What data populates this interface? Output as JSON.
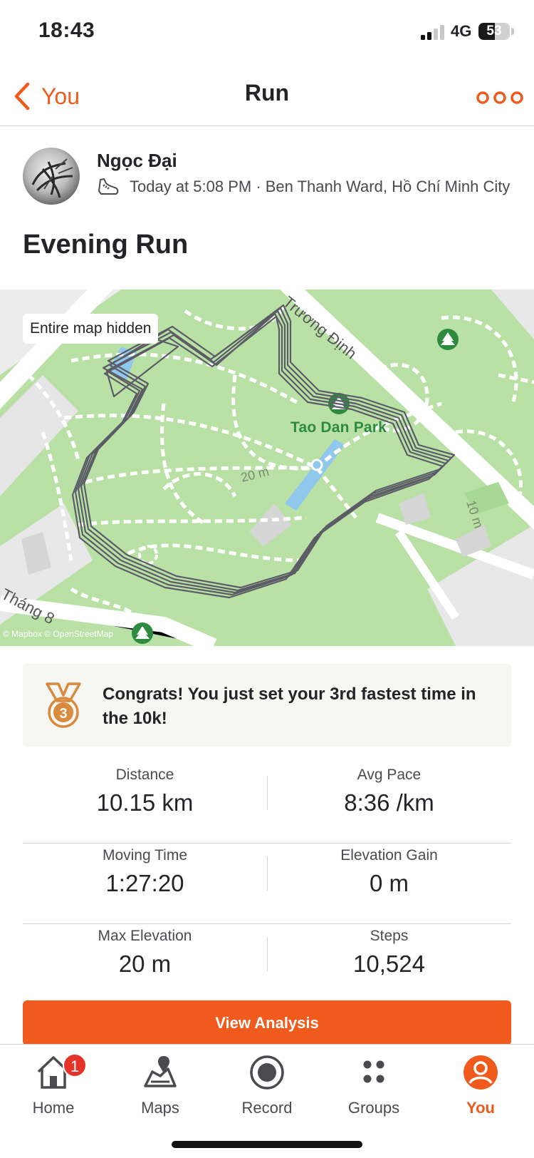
{
  "status_bar": {
    "time": "18:43",
    "network": "4G",
    "battery": "53",
    "battery_level": 0.53
  },
  "nav": {
    "back_label": "You",
    "title": "Run",
    "more_icon": "more-icon"
  },
  "athlete": {
    "name": "Ngọc Đại",
    "meta": "Today at 5:08 PM · Ben Thanh Ward, Hồ Chí Minh City",
    "activity_icon": "shoe-icon"
  },
  "activity_title": "Evening Run",
  "map": {
    "privacy_badge": "Entire map hidden",
    "park_label": "Tao Dan Park",
    "street_top": "Trương Định",
    "street_bottom": "Tháng 8",
    "contour_center": "20 m",
    "contour_right": "10 m",
    "credit": "© Mapbox © OpenStreetMap"
  },
  "achievement": {
    "rank": "3",
    "text": "Congrats! You just set your 3rd fastest time in the 10k!"
  },
  "stats": [
    {
      "left": {
        "label": "Distance",
        "value": "10.15 km"
      },
      "right": {
        "label": "Avg Pace",
        "value": "8:36 /km"
      }
    },
    {
      "left": {
        "label": "Moving Time",
        "value": "1:27:20"
      },
      "right": {
        "label": "Elevation Gain",
        "value": "0 m"
      }
    },
    {
      "left": {
        "label": "Max Elevation",
        "value": "20 m"
      },
      "right": {
        "label": "Steps",
        "value": "10,524"
      }
    }
  ],
  "view_analysis_label": "View Analysis",
  "tabs": [
    {
      "label": "Home",
      "icon": "home-icon",
      "badge": "1"
    },
    {
      "label": "Maps",
      "icon": "maps-icon"
    },
    {
      "label": "Record",
      "icon": "record-icon"
    },
    {
      "label": "Groups",
      "icon": "groups-icon"
    },
    {
      "label": "You",
      "icon": "profile-icon",
      "active": true
    }
  ],
  "colors": {
    "accent": "#f05a1c",
    "route": "#5c5c66",
    "park": "#b8e0a5",
    "medal": "#d98a3c"
  }
}
